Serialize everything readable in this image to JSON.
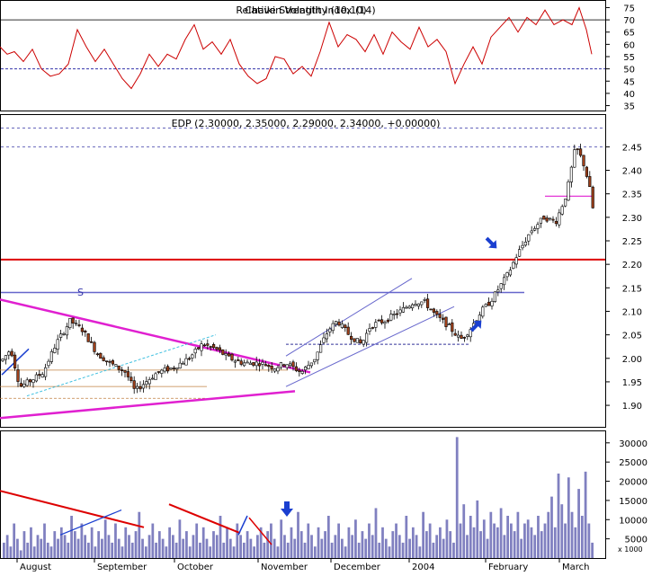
{
  "rsi": {
    "title": "Relative Strength Index (14)",
    "overlay_title": "Chaikin Volatility (10,10)",
    "ticks": [
      75,
      70,
      65,
      60,
      55,
      50,
      45,
      40,
      35
    ],
    "overbought": 70,
    "oversold": 50
  },
  "price": {
    "title": "EDP (2.30000, 2.35000, 2.29000, 2.34000, +0.00000)",
    "ticks": [
      "2.45",
      "2.40",
      "2.35",
      "2.30",
      "2.25",
      "2.20",
      "2.15",
      "2.10",
      "2.05",
      "2.00",
      "1.95",
      "1.90"
    ],
    "support_level": 2.21,
    "resistance_level": 2.14,
    "pattern_label": "S"
  },
  "volume": {
    "ticks": [
      "30000",
      "25000",
      "20000",
      "15000",
      "10000",
      "5000"
    ],
    "unit_label": "x 1000"
  },
  "months": [
    "August",
    "September",
    "October",
    "November",
    "December",
    "2004",
    "February",
    "March"
  ],
  "colors": {
    "up_candle": "#ffffff",
    "down_candle": "#a0401a",
    "rsi_line": "#cc0000",
    "trend_magenta": "#e020d0",
    "channel": "#6666cc",
    "volume_bar": "#8080c0",
    "support_red": "#dd0000",
    "arrow_blue": "#1a3fd0"
  },
  "chart_data": {
    "type": "candlestick",
    "title": "EDP (2.30000, 2.35000, 2.29000, 2.34000, +0.00000)",
    "last": {
      "open": 2.3,
      "high": 2.35,
      "low": 2.29,
      "close": 2.34,
      "change": 0.0
    },
    "y_range": [
      1.86,
      2.51
    ],
    "key_levels": [
      2.21,
      2.14,
      2.03
    ],
    "price_path": [
      [
        0,
        1.99
      ],
      [
        12,
        2.02
      ],
      [
        22,
        1.94
      ],
      [
        32,
        1.95
      ],
      [
        48,
        1.97
      ],
      [
        62,
        2.03
      ],
      [
        78,
        2.08
      ],
      [
        92,
        2.06
      ],
      [
        108,
        2.01
      ],
      [
        122,
        1.99
      ],
      [
        140,
        1.97
      ],
      [
        150,
        1.93
      ],
      [
        162,
        1.95
      ],
      [
        175,
        1.97
      ],
      [
        192,
        1.98
      ],
      [
        210,
        2.0
      ],
      [
        225,
        2.03
      ],
      [
        240,
        2.02
      ],
      [
        255,
        2.0
      ],
      [
        270,
        1.99
      ],
      [
        290,
        1.99
      ],
      [
        305,
        1.98
      ],
      [
        318,
        1.99
      ],
      [
        335,
        1.97
      ],
      [
        350,
        2.0
      ],
      [
        365,
        2.06
      ],
      [
        375,
        2.08
      ],
      [
        388,
        2.05
      ],
      [
        402,
        2.03
      ],
      [
        412,
        2.07
      ],
      [
        428,
        2.08
      ],
      [
        445,
        2.1
      ],
      [
        460,
        2.12
      ],
      [
        472,
        2.12
      ],
      [
        485,
        2.09
      ],
      [
        498,
        2.07
      ],
      [
        512,
        2.04
      ],
      [
        522,
        2.06
      ],
      [
        535,
        2.1
      ],
      [
        545,
        2.12
      ],
      [
        555,
        2.15
      ],
      [
        565,
        2.18
      ],
      [
        575,
        2.22
      ],
      [
        590,
        2.27
      ],
      [
        605,
        2.3
      ],
      [
        618,
        2.29
      ],
      [
        630,
        2.35
      ],
      [
        640,
        2.45
      ],
      [
        648,
        2.42
      ],
      [
        655,
        2.37
      ],
      [
        660,
        2.31
      ]
    ],
    "rsi": {
      "name": "RSI (14)",
      "ylim": [
        33,
        77
      ],
      "values": [
        [
          0,
          59
        ],
        [
          8,
          56
        ],
        [
          16,
          57
        ],
        [
          26,
          53
        ],
        [
          36,
          58
        ],
        [
          46,
          50
        ],
        [
          56,
          47
        ],
        [
          66,
          48
        ],
        [
          76,
          52
        ],
        [
          86,
          66
        ],
        [
          96,
          59
        ],
        [
          106,
          53
        ],
        [
          116,
          58
        ],
        [
          126,
          52
        ],
        [
          136,
          46
        ],
        [
          146,
          42
        ],
        [
          156,
          48
        ],
        [
          166,
          56
        ],
        [
          176,
          51
        ],
        [
          186,
          56
        ],
        [
          196,
          54
        ],
        [
          206,
          62
        ],
        [
          216,
          68
        ],
        [
          226,
          58
        ],
        [
          236,
          61
        ],
        [
          246,
          56
        ],
        [
          256,
          62
        ],
        [
          266,
          52
        ],
        [
          276,
          47
        ],
        [
          286,
          44
        ],
        [
          296,
          46
        ],
        [
          306,
          55
        ],
        [
          316,
          54
        ],
        [
          326,
          48
        ],
        [
          336,
          51
        ],
        [
          346,
          47
        ],
        [
          356,
          57
        ],
        [
          366,
          69
        ],
        [
          376,
          59
        ],
        [
          386,
          64
        ],
        [
          396,
          62
        ],
        [
          406,
          57
        ],
        [
          416,
          64
        ],
        [
          426,
          56
        ],
        [
          436,
          65
        ],
        [
          446,
          61
        ],
        [
          456,
          58
        ],
        [
          466,
          67
        ],
        [
          476,
          59
        ],
        [
          486,
          62
        ],
        [
          496,
          57
        ],
        [
          506,
          44
        ],
        [
          516,
          52
        ],
        [
          526,
          59
        ],
        [
          536,
          52
        ],
        [
          546,
          63
        ],
        [
          556,
          67
        ],
        [
          566,
          71
        ],
        [
          576,
          65
        ],
        [
          586,
          71
        ],
        [
          596,
          68
        ],
        [
          606,
          74
        ],
        [
          616,
          68
        ],
        [
          626,
          70
        ],
        [
          636,
          68
        ],
        [
          644,
          75
        ],
        [
          652,
          66
        ],
        [
          658,
          56
        ]
      ]
    },
    "volume": {
      "name": "Volume",
      "ylim": [
        0,
        33000
      ],
      "values": [
        4000,
        6000,
        3000,
        9000,
        5000,
        2000,
        7000,
        4000,
        8000,
        3000,
        6000,
        5000,
        9000,
        4000,
        3000,
        7000,
        5000,
        8000,
        6000,
        4000,
        11000,
        7000,
        5000,
        9000,
        6000,
        4000,
        8000,
        3000,
        7000,
        5000,
        10000,
        6000,
        4000,
        9000,
        5000,
        3000,
        8000,
        6000,
        4000,
        7000,
        12000,
        5000,
        3000,
        6000,
        9000,
        4000,
        7000,
        5000,
        3000,
        8000,
        6000,
        4000,
        10000,
        5000,
        7000,
        3000,
        6000,
        9000,
        4000,
        8000,
        5000,
        3000,
        7000,
        6000,
        11000,
        4000,
        8000,
        5000,
        3000,
        9000,
        6000,
        4000,
        7000,
        5000,
        3000,
        6000,
        8000,
        4000,
        7000,
        9000,
        5000,
        3000,
        10000,
        6000,
        4000,
        8000,
        5000,
        12000,
        7000,
        4000,
        9000,
        6000,
        3000,
        8000,
        5000,
        7000,
        11000,
        4000,
        6000,
        9000,
        5000,
        3000,
        8000,
        6000,
        10000,
        4000,
        7000,
        5000,
        9000,
        6000,
        13000,
        4000,
        8000,
        5000,
        3000,
        7000,
        9000,
        6000,
        4000,
        11000,
        5000,
        8000,
        6000,
        3000,
        12000,
        7000,
        9000,
        4000,
        6000,
        8000,
        5000,
        10000,
        7000,
        4000,
        31500,
        9000,
        14000,
        6000,
        11000,
        8000,
        15000,
        7000,
        10000,
        5000,
        12000,
        9000,
        8000,
        13000,
        6000,
        11000,
        9000,
        7000,
        12000,
        5000,
        9000,
        10000,
        8000,
        6000,
        11000,
        7000,
        9000,
        12000,
        16000,
        8000,
        22000,
        14000,
        9000,
        21000,
        12000,
        8000,
        18000,
        11000,
        22500,
        9000,
        4000
      ]
    }
  }
}
